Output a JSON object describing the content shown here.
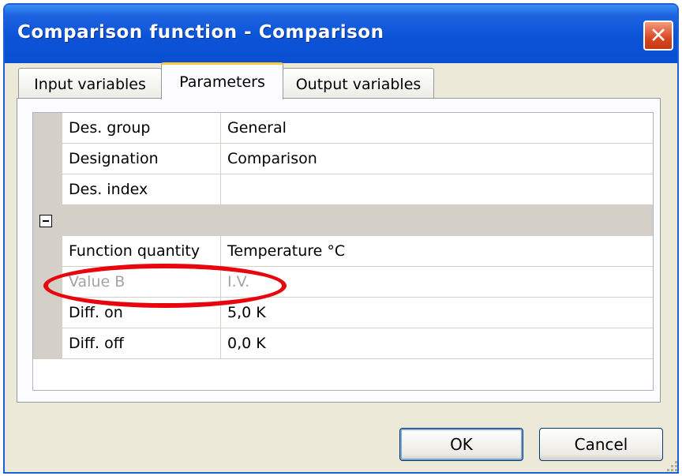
{
  "window": {
    "title": "Comparison function - Comparison",
    "close_icon": "close-icon"
  },
  "tabs": [
    {
      "label": "Input variables",
      "active": false
    },
    {
      "label": "Parameters",
      "active": true
    },
    {
      "label": "Output variables",
      "active": false
    }
  ],
  "params": {
    "rows_top": [
      {
        "name": "Des. group",
        "value": "General"
      },
      {
        "name": "Designation",
        "value": "Comparison"
      },
      {
        "name": "Des. index",
        "value": ""
      }
    ],
    "group": {
      "expanded": true,
      "icon": "collapse-minus-icon"
    },
    "rows_group": [
      {
        "name": "Function quantity",
        "value": "Temperature °C",
        "disabled": false
      },
      {
        "name": "Value B",
        "value": "I.V.",
        "disabled": true
      },
      {
        "name": "Diff. on",
        "value": "5,0 K",
        "disabled": false
      },
      {
        "name": "Diff. off",
        "value": "0,0 K",
        "disabled": false
      }
    ]
  },
  "annotation": {
    "type": "ellipse",
    "color": "#e8060e",
    "target": "Value B"
  },
  "buttons": {
    "ok": "OK",
    "cancel": "Cancel"
  },
  "colors": {
    "titlebar": "#0b53d8",
    "tab_highlight": "#ffc83c",
    "frame": "#ece9d8",
    "annotation": "#e8060e"
  }
}
